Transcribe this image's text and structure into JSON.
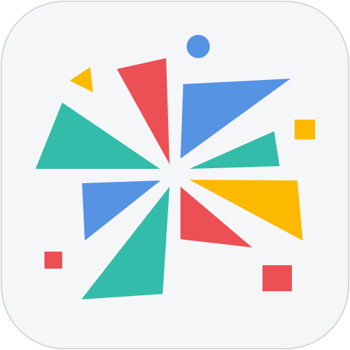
{
  "icon": {
    "name": "pinwheel-app-icon",
    "shape": "rounded-square",
    "colors": {
      "background": "#f5f6f8",
      "border": "#d5d6d8",
      "red": "#ec5054",
      "blue": "#5793e3",
      "teal": "#33bcaa",
      "yellow": "#fbba00"
    }
  }
}
